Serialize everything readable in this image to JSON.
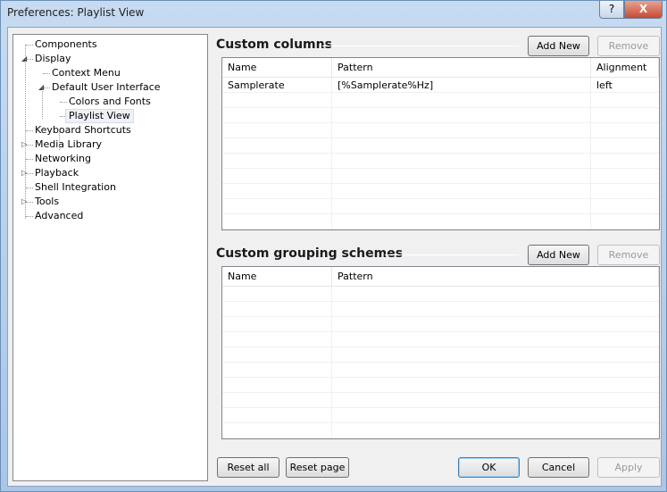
{
  "window": {
    "title": "Preferences: Playlist View",
    "help": "?",
    "close": "X"
  },
  "tree": [
    {
      "label": "Components",
      "level": 0,
      "expander": ""
    },
    {
      "label": "Display",
      "level": 0,
      "expander": "expanded"
    },
    {
      "label": "Context Menu",
      "level": 1,
      "expander": ""
    },
    {
      "label": "Default User Interface",
      "level": 1,
      "expander": "expanded"
    },
    {
      "label": "Colors and Fonts",
      "level": 2,
      "expander": ""
    },
    {
      "label": "Playlist View",
      "level": 2,
      "expander": "",
      "selected": true
    },
    {
      "label": "Keyboard Shortcuts",
      "level": 0,
      "expander": ""
    },
    {
      "label": "Media Library",
      "level": 0,
      "expander": "collapsed"
    },
    {
      "label": "Networking",
      "level": 0,
      "expander": ""
    },
    {
      "label": "Playback",
      "level": 0,
      "expander": "collapsed"
    },
    {
      "label": "Shell Integration",
      "level": 0,
      "expander": ""
    },
    {
      "label": "Tools",
      "level": 0,
      "expander": "collapsed"
    },
    {
      "label": "Advanced",
      "level": 0,
      "expander": ""
    }
  ],
  "columns": {
    "heading": "Custom columns",
    "add": "Add New",
    "remove": "Remove",
    "headers": [
      "Name",
      "Pattern",
      "Alignment"
    ],
    "rows": [
      [
        "Samplerate",
        "[%Samplerate%Hz]",
        "left"
      ]
    ]
  },
  "grouping": {
    "heading": "Custom grouping schemes",
    "add": "Add New",
    "remove": "Remove",
    "headers": [
      "Name",
      "Pattern"
    ],
    "rows": []
  },
  "footer": {
    "reset_all": "Reset all",
    "reset_page": "Reset page",
    "ok": "OK",
    "cancel": "Cancel",
    "apply": "Apply"
  }
}
